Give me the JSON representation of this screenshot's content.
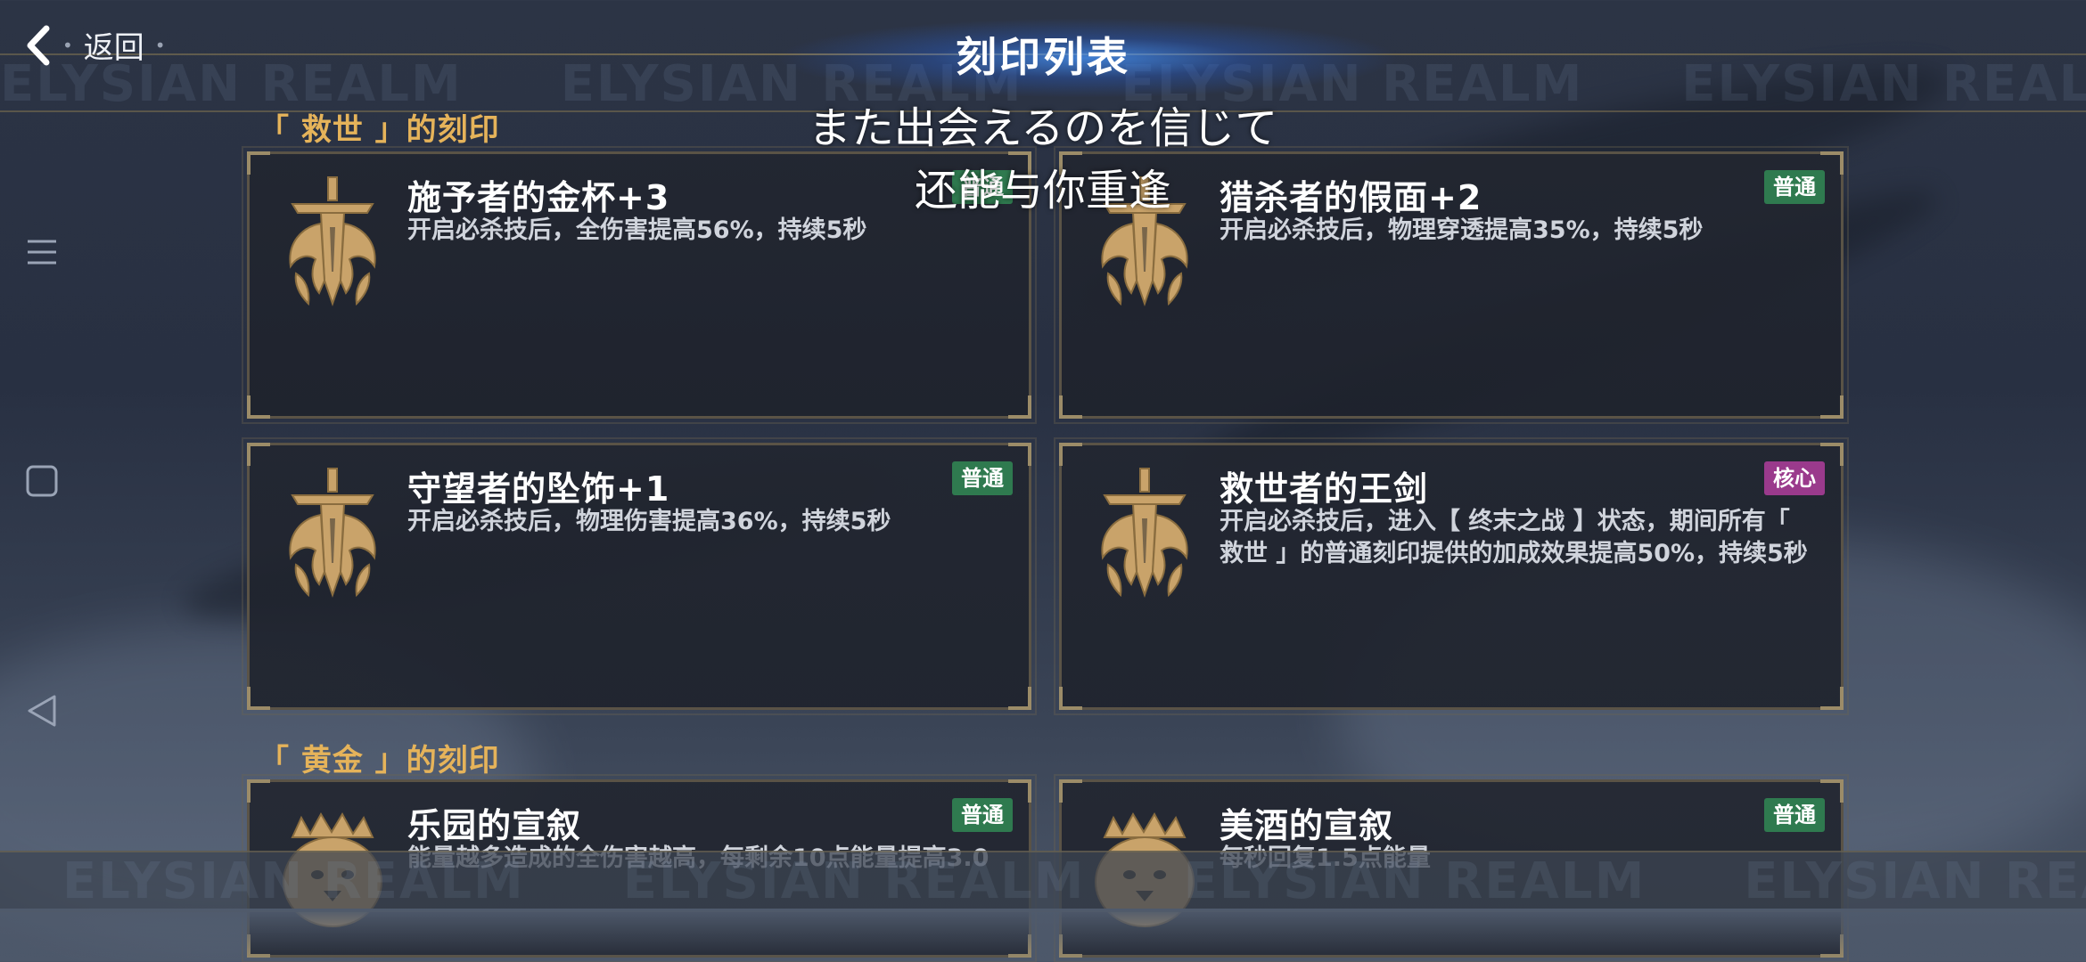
{
  "header": {
    "title": "刻印列表",
    "back_label": "返回",
    "watermark": "ELYSIAN REALM"
  },
  "subtitles": {
    "line1": "また出会えるのを信じて",
    "line2": "还能与你重逢"
  },
  "nav": {
    "menu_icon": "menu-icon",
    "home_icon": "square-icon",
    "back_icon": "triangle-back-icon"
  },
  "sections": [
    {
      "header": "「 救世 」的刻印",
      "cards": [
        {
          "name": "施予者的金杯+3",
          "desc": "开启必杀技后，全伤害提高56%，持续5秒",
          "badge": "普通",
          "badge_type": "normal"
        },
        {
          "name": "猎杀者的假面+2",
          "desc": "开启必杀技后，物理穿透提高35%，持续5秒",
          "badge": "普通",
          "badge_type": "normal"
        },
        {
          "name": "守望者的坠饰+1",
          "desc": "开启必杀技后，物理伤害提高36%，持续5秒",
          "badge": "普通",
          "badge_type": "normal"
        },
        {
          "name": "救世者的王剑",
          "desc": "开启必杀技后，进入【 终末之战 】状态，期间所有「 救世 」的普通刻印提供的加成效果提高50%，持续5秒",
          "badge": "核心",
          "badge_type": "core"
        }
      ]
    },
    {
      "header": "「 黄金 」的刻印",
      "cards": [
        {
          "name": "乐园的宣叙",
          "desc": "能量越多造成的全伤害越高，每剩余10点能量提高3.0",
          "badge": "普通",
          "badge_type": "normal"
        },
        {
          "name": "美酒的宣叙",
          "desc": "每秒回复1.5点能量",
          "badge": "普通",
          "badge_type": "normal"
        }
      ]
    }
  ],
  "colors": {
    "accent_gold": "#e5b35a",
    "badge_normal": "#2f7a4f",
    "badge_core": "#9a3a8c",
    "emblem_gold": "#c9a36a"
  }
}
